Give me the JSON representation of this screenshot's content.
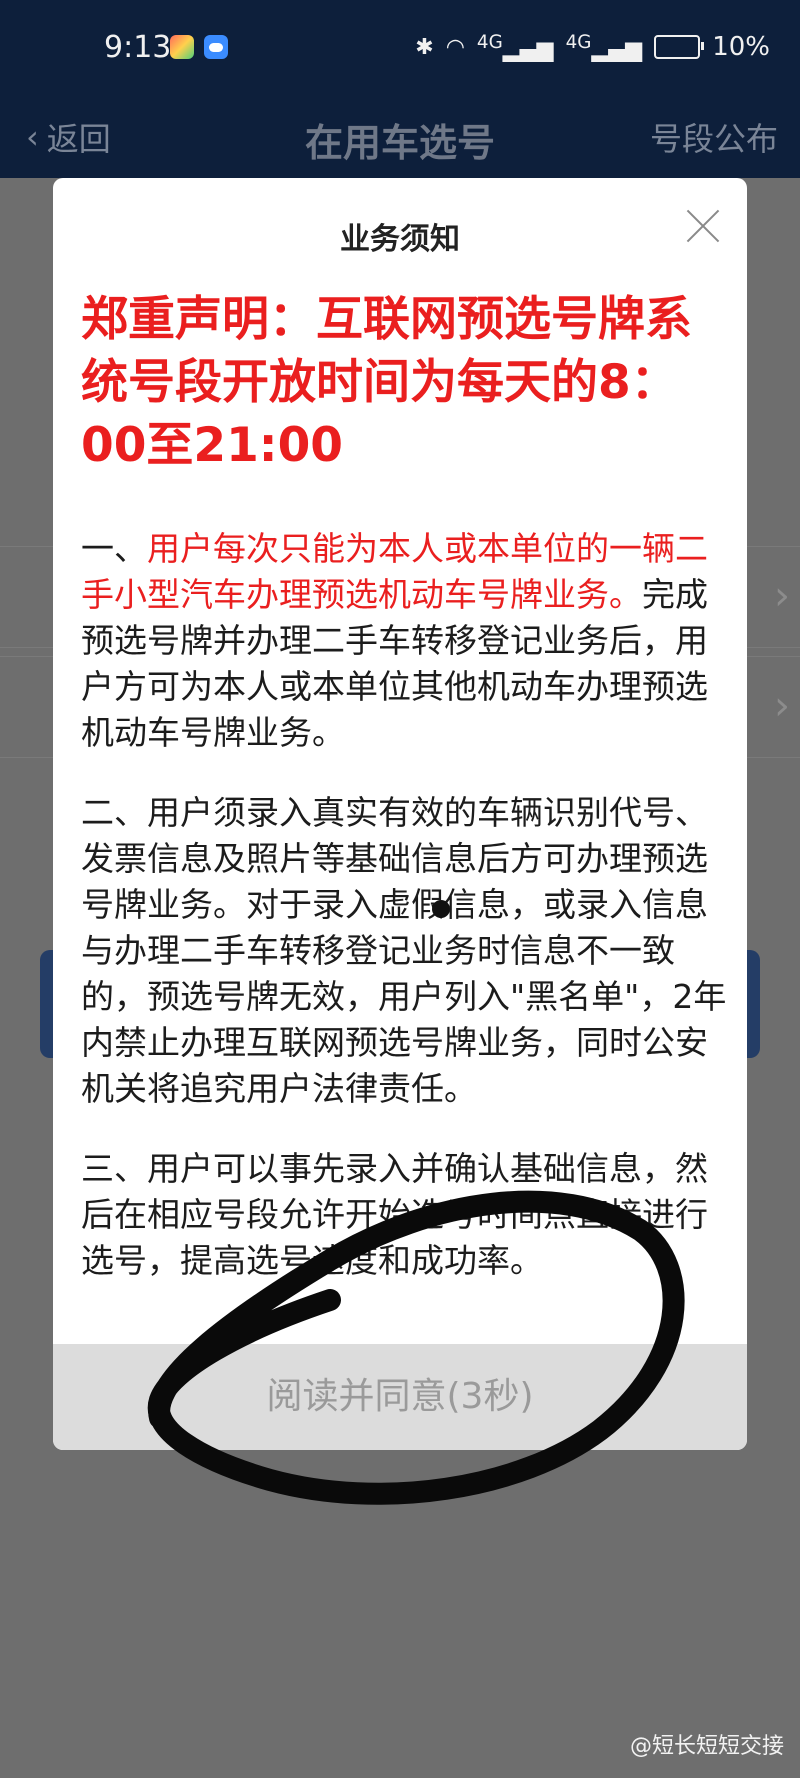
{
  "status_bar": {
    "time": "9:13",
    "network1": "4G",
    "network2": "4G",
    "battery": "10%"
  },
  "nav": {
    "back_label": "返回",
    "title": "在用车选号",
    "right_label": "号段公布"
  },
  "modal": {
    "title": "业务须知",
    "declaration": "郑重声明：互联网预选号牌系统号段开放时间为每天的8：00至21:00",
    "p1_prefix": "一、",
    "p1_red": "用户每次只能为本人或本单位的一辆二手小型汽车办理预选机动车号牌业务。",
    "p1_rest": "完成预选号牌并办理二手车转移登记业务后，用户方可为本人或本单位其他机动车办理预选机动车号牌业务。",
    "p2": "二、用户须录入真实有效的车辆识别代号、发票信息及照片等基础信息后方可办理预选号牌业务。对于录入虚假信息，或录入信息与办理二手车转移登记业务时信息不一致的，预选号牌无效，用户列入\"黑名单\"，2年内禁止办理互联网预选号牌业务，同时公安机关将追究用户法律责任。",
    "p3": "三、用户可以事先录入并确认基础信息，然后在相应号段允许开始选号时间点直接进行选号，提高选号速度和成功率。",
    "agree_button": "阅读并同意(3秒)"
  },
  "watermark": "@短长短短交接",
  "icons": [
    "bluetooth-icon",
    "wifi-icon",
    "signal-icon",
    "battery-icon",
    "back-chevron-icon",
    "close-icon"
  ]
}
